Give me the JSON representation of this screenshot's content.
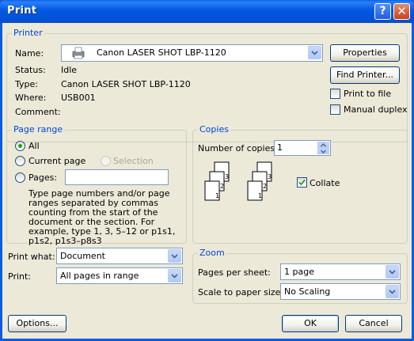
{
  "window": {
    "title": "Print",
    "help_glyph": "?",
    "close_glyph": "✕"
  },
  "printer": {
    "group": "Printer",
    "name_label": "Name:",
    "name_value": "Canon LASER SHOT LBP-1120",
    "status_label": "Status:",
    "status_value": "Idle",
    "type_label": "Type:",
    "type_value": "Canon LASER SHOT LBP-1120",
    "where_label": "Where:",
    "where_value": "USB001",
    "comment_label": "Comment:",
    "properties_button": "Properties",
    "find_printer_button": "Find Printer...",
    "print_to_file_label": "Print to file",
    "print_to_file_checked": false,
    "manual_duplex_label": "Manual duplex",
    "manual_duplex_checked": false
  },
  "page_range": {
    "group": "Page range",
    "all_label": "All",
    "current_page_label": "Current page",
    "selection_label": "Selection",
    "pages_label": "Pages:",
    "pages_value": "",
    "selected": "all",
    "help_text": "Type page numbers and/or page ranges separated by commas counting from the start of the document or the section. For example, type 1, 3, 5–12 or p1s1, p1s2, p1s3–p8s3"
  },
  "copies": {
    "group": "Copies",
    "number_label": "Number of copies:",
    "number_value": "1",
    "collate_label": "Collate",
    "collate_checked": true,
    "page_numbers": [
      "1",
      "2",
      "3"
    ]
  },
  "print_what": {
    "label": "Print what:",
    "value": "Document"
  },
  "print": {
    "label": "Print:",
    "value": "All pages in range"
  },
  "zoom": {
    "group": "Zoom",
    "pages_per_sheet_label": "Pages per sheet:",
    "pages_per_sheet_value": "1 page",
    "scale_label": "Scale to paper size:",
    "scale_value": "No Scaling"
  },
  "footer": {
    "options_button": "Options...",
    "ok_button": "OK",
    "cancel_button": "Cancel"
  },
  "colors": {
    "title_bar": "#0a5de0",
    "dialog_bg": "#ece9d8",
    "group_title": "#0046d5",
    "button_border": "#003c74"
  }
}
